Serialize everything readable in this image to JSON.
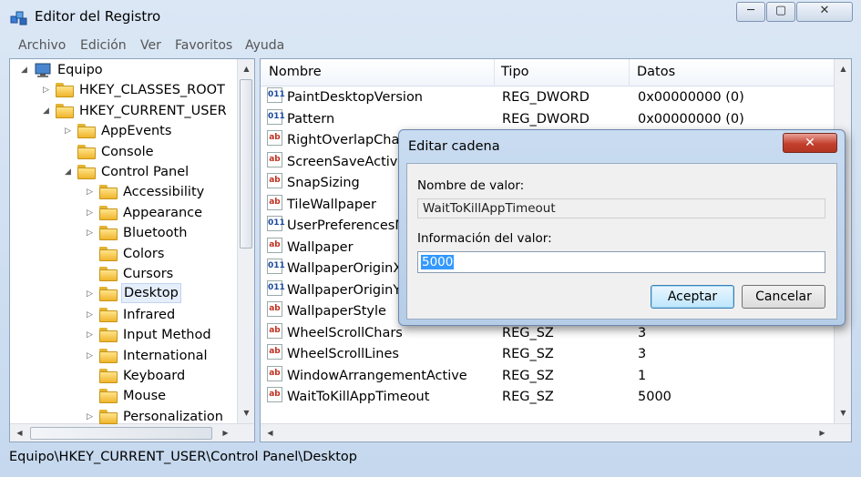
{
  "window": {
    "title": "Editor del Registro",
    "min_glyph": "─",
    "max_glyph": "▢",
    "close_glyph": "✕"
  },
  "menu": [
    "Archivo",
    "Edición",
    "Ver",
    "Favoritos",
    "Ayuda"
  ],
  "tree": [
    {
      "label": "Equipo",
      "level": 0,
      "expander": "open",
      "icon": "computer-icon"
    },
    {
      "label": "HKEY_CLASSES_ROOT",
      "level": 1,
      "expander": "closed",
      "icon": "folder-icon"
    },
    {
      "label": "HKEY_CURRENT_USER",
      "level": 1,
      "expander": "open",
      "icon": "folder-icon"
    },
    {
      "label": "AppEvents",
      "level": 2,
      "expander": "closed",
      "icon": "folder-icon"
    },
    {
      "label": "Console",
      "level": 2,
      "expander": "none",
      "icon": "folder-icon"
    },
    {
      "label": "Control Panel",
      "level": 2,
      "expander": "open",
      "icon": "folder-icon"
    },
    {
      "label": "Accessibility",
      "level": 3,
      "expander": "closed",
      "icon": "folder-icon"
    },
    {
      "label": "Appearance",
      "level": 3,
      "expander": "closed",
      "icon": "folder-icon"
    },
    {
      "label": "Bluetooth",
      "level": 3,
      "expander": "closed",
      "icon": "folder-icon"
    },
    {
      "label": "Colors",
      "level": 3,
      "expander": "none",
      "icon": "folder-icon"
    },
    {
      "label": "Cursors",
      "level": 3,
      "expander": "none",
      "icon": "folder-icon"
    },
    {
      "label": "Desktop",
      "level": 3,
      "expander": "closed",
      "icon": "folder-icon",
      "selected": true
    },
    {
      "label": "Infrared",
      "level": 3,
      "expander": "closed",
      "icon": "folder-icon"
    },
    {
      "label": "Input Method",
      "level": 3,
      "expander": "closed",
      "icon": "folder-icon"
    },
    {
      "label": "International",
      "level": 3,
      "expander": "closed",
      "icon": "folder-icon"
    },
    {
      "label": "Keyboard",
      "level": 3,
      "expander": "none",
      "icon": "folder-icon"
    },
    {
      "label": "Mouse",
      "level": 3,
      "expander": "none",
      "icon": "folder-icon"
    },
    {
      "label": "Personalization",
      "level": 3,
      "expander": "closed",
      "icon": "folder-icon"
    }
  ],
  "list": {
    "columns": [
      "Nombre",
      "Tipo",
      "Datos"
    ],
    "rows": [
      {
        "icon": "dword",
        "name": "PaintDesktopVersion",
        "type": "REG_DWORD",
        "data": "0x00000000 (0)"
      },
      {
        "icon": "dword",
        "name": "Pattern",
        "type": "REG_DWORD",
        "data": "0x00000000 (0)"
      },
      {
        "icon": "sz",
        "name": "RightOverlapChars",
        "type": "",
        "data": ""
      },
      {
        "icon": "sz",
        "name": "ScreenSaveActive",
        "type": "",
        "data": ""
      },
      {
        "icon": "sz",
        "name": "SnapSizing",
        "type": "",
        "data": ""
      },
      {
        "icon": "sz",
        "name": "TileWallpaper",
        "type": "",
        "data": ""
      },
      {
        "icon": "dword",
        "name": "UserPreferencesMa",
        "type": "",
        "data": ""
      },
      {
        "icon": "sz",
        "name": "Wallpaper",
        "type": "",
        "data": ""
      },
      {
        "icon": "dword",
        "name": "WallpaperOriginX",
        "type": "",
        "data": ""
      },
      {
        "icon": "dword",
        "name": "WallpaperOriginY",
        "type": "",
        "data": ""
      },
      {
        "icon": "sz",
        "name": "WallpaperStyle",
        "type": "",
        "data": ""
      },
      {
        "icon": "sz",
        "name": "WheelScrollChars",
        "type": "REG_SZ",
        "data": "3"
      },
      {
        "icon": "sz",
        "name": "WheelScrollLines",
        "type": "REG_SZ",
        "data": "3"
      },
      {
        "icon": "sz",
        "name": "WindowArrangementActive",
        "type": "REG_SZ",
        "data": "1"
      },
      {
        "icon": "sz",
        "name": "WaitToKillAppTimeout",
        "type": "REG_SZ",
        "data": "5000"
      }
    ],
    "icon_text": {
      "sz": "ab",
      "dword": "011"
    }
  },
  "status": "Equipo\\HKEY_CURRENT_USER\\Control Panel\\Desktop",
  "dialog": {
    "title": "Editar cadena",
    "close_glyph": "✕",
    "name_label": "Nombre de valor:",
    "name_value": "WaitToKillAppTimeout",
    "data_label": "Información del valor:",
    "data_value": "5000",
    "ok": "Aceptar",
    "cancel": "Cancelar"
  },
  "colors": {
    "selection": "#3399ff",
    "close_red": "#c3402d"
  }
}
